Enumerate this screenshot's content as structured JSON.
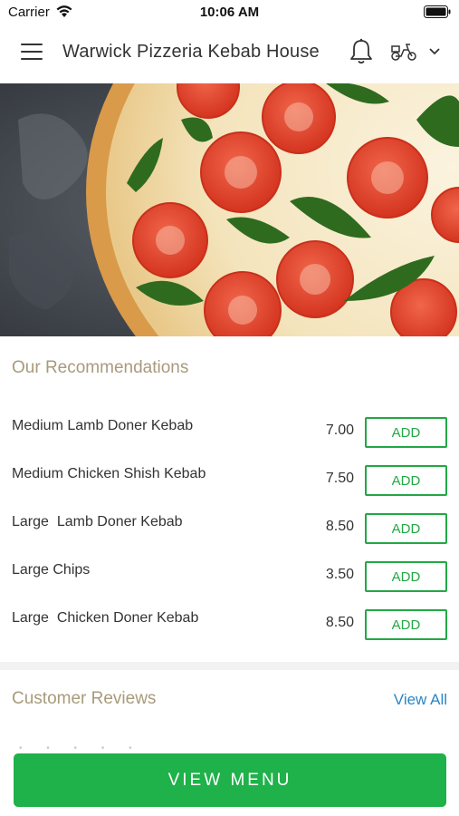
{
  "status_bar": {
    "carrier": "Carrier",
    "time": "10:06 AM"
  },
  "header": {
    "title": "Warwick Pizzeria Kebab House",
    "icons": [
      "menu-icon",
      "bell-icon",
      "scooter-icon",
      "chevron-down-icon"
    ]
  },
  "recommendations": {
    "heading": "Our Recommendations",
    "add_label": "ADD",
    "items": [
      {
        "name": "Medium Lamb Doner Kebab",
        "price": "7.00"
      },
      {
        "name": "Medium Chicken Shish Kebab",
        "price": "7.50"
      },
      {
        "name": "Large  Lamb Doner Kebab",
        "price": "8.50"
      },
      {
        "name": "Large Chips",
        "price": "3.50"
      },
      {
        "name": "Large  Chicken Doner Kebab",
        "price": "8.50"
      }
    ]
  },
  "reviews": {
    "heading": "Customer Reviews",
    "view_all": "View All"
  },
  "view_menu_label": "VIEW MENU",
  "colors": {
    "accent_green": "#1fb14a",
    "heading_tan": "#a89a7c",
    "link_blue": "#2b86c4"
  }
}
